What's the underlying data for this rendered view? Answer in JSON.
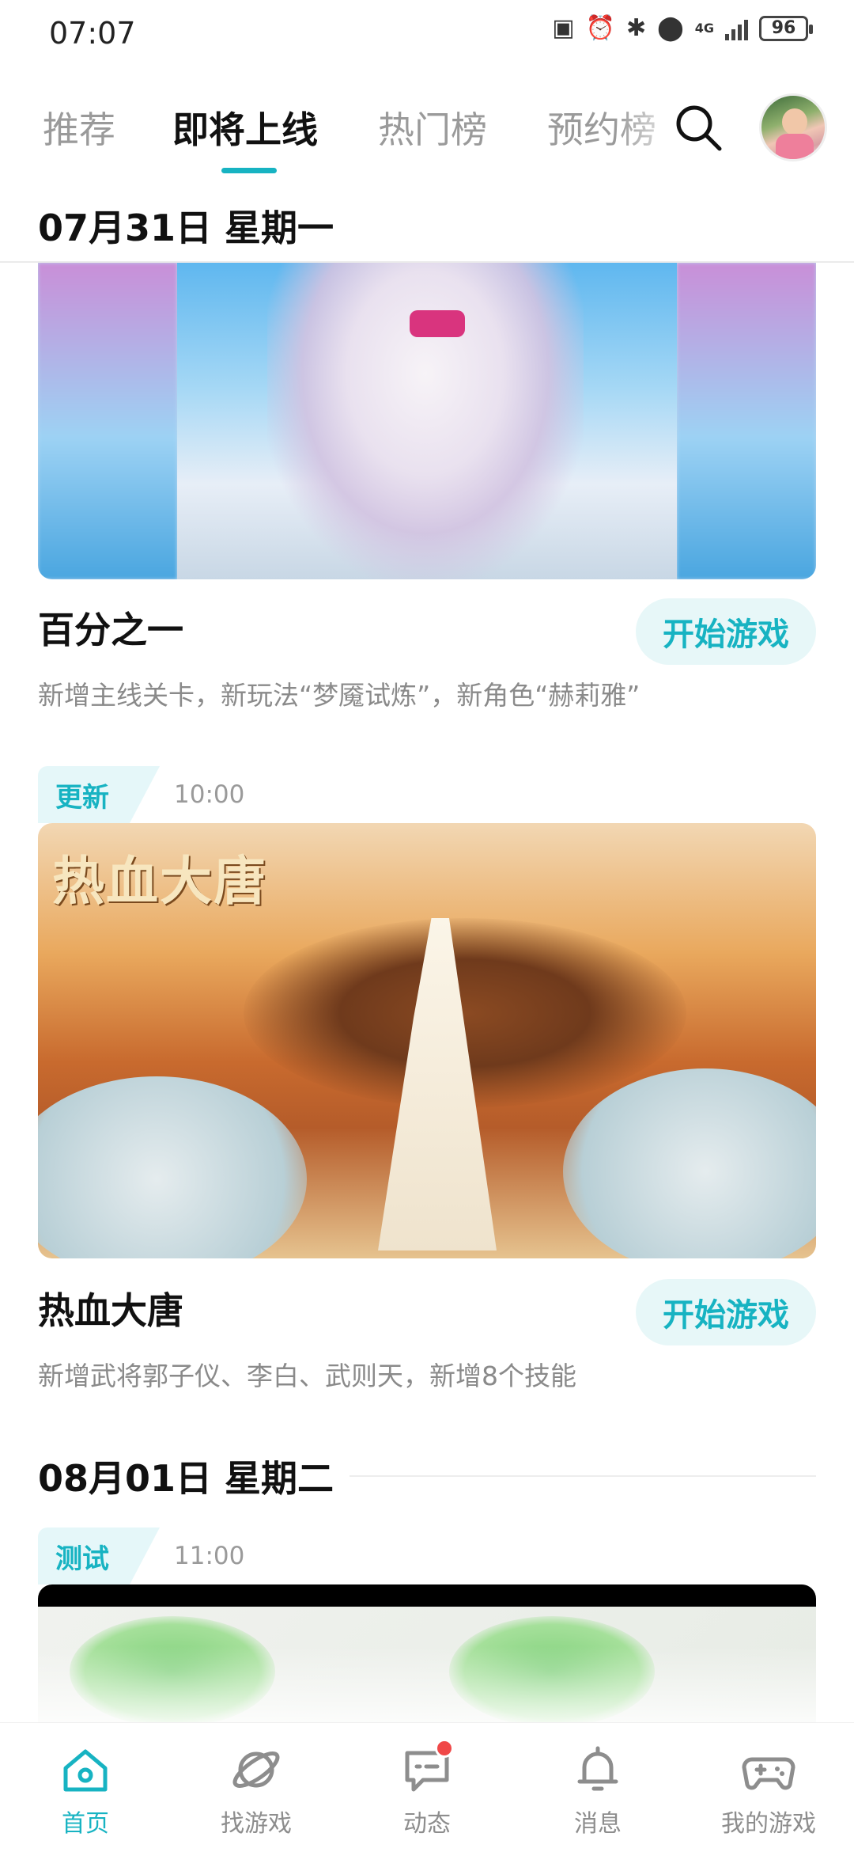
{
  "status_bar": {
    "time": "07:07",
    "battery": "96",
    "network": "4G"
  },
  "tabs": [
    {
      "label": "推荐",
      "active": false
    },
    {
      "label": "即将上线",
      "active": true
    },
    {
      "label": "热门榜",
      "active": false
    },
    {
      "label": "预约榜",
      "active": false
    }
  ],
  "accent_color": "#17b3c2",
  "sections": [
    {
      "date": "07月31日 星期一",
      "games": [
        {
          "title": "百分之一",
          "button": "开始游戏",
          "desc": "新增主线关卡，新玩法“梦魇试炼”，新角色“赫莉雅”"
        },
        {
          "tag": "更新",
          "time": "10:00",
          "banner_text": "热血大唐",
          "title": "热血大唐",
          "button": "开始游戏",
          "desc": "新增武将郭子仪、李白、武则天，新增8个技能"
        }
      ]
    },
    {
      "date": "08月01日 星期二",
      "games": [
        {
          "tag": "测试",
          "time": "11:00"
        }
      ]
    }
  ],
  "bottom_nav": [
    {
      "label": "首页",
      "icon": "home-icon",
      "active": true
    },
    {
      "label": "找游戏",
      "icon": "planet-icon",
      "active": false
    },
    {
      "label": "动态",
      "icon": "chat-icon",
      "active": false,
      "badge": true
    },
    {
      "label": "消息",
      "icon": "bell-icon",
      "active": false
    },
    {
      "label": "我的游戏",
      "icon": "gamepad-icon",
      "active": false
    }
  ]
}
